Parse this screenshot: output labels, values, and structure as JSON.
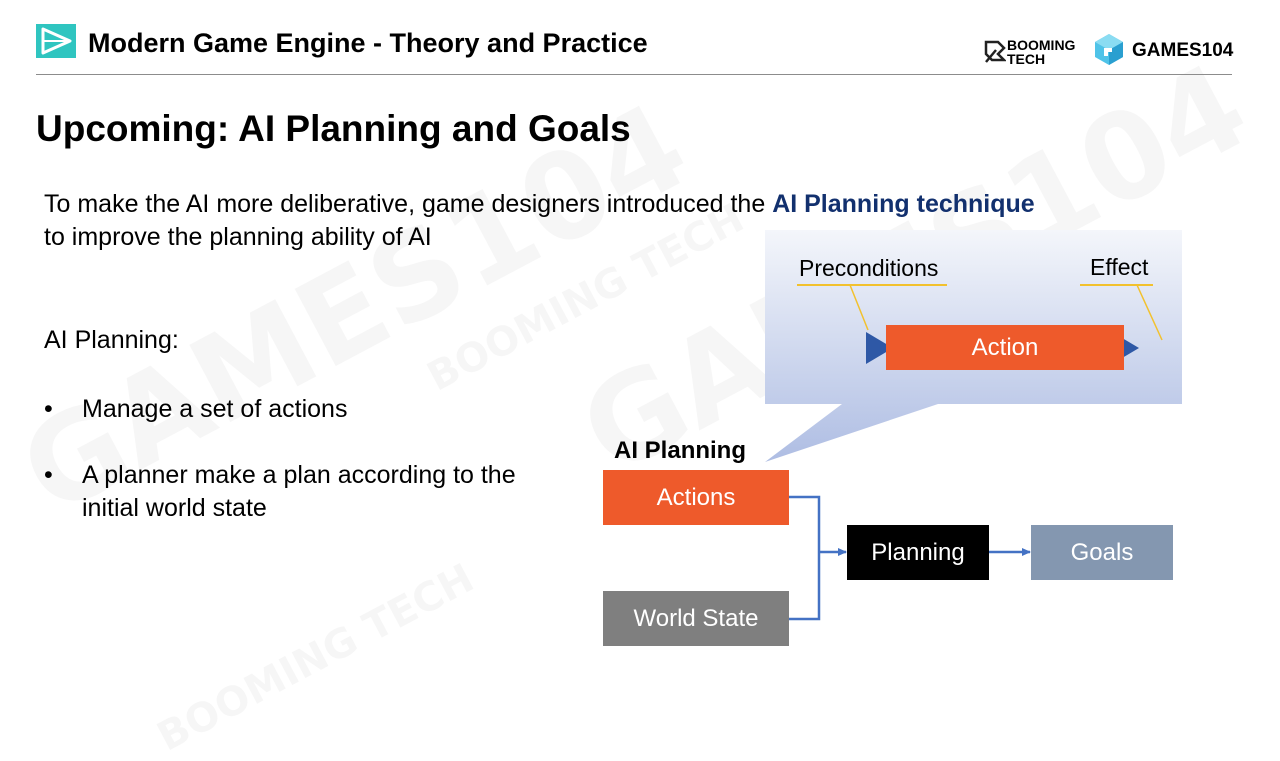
{
  "header": {
    "title": "Modern Game Engine - Theory and Practice",
    "logo_booming_line1": "BOOMING",
    "logo_booming_line2": "TECH",
    "logo_games": "GAMES104"
  },
  "slide": {
    "title": "Upcoming: AI Planning and Goals",
    "intro_line1_pre": "To make the AI more deliberative, game designers introduced the ",
    "intro_line1_highlight": "AI Planning technique",
    "intro_line2": "to improve the planning ability of AI",
    "ai_planning_label": "AI Planning:",
    "bullets": [
      "Manage a set of actions",
      "A planner make a plan according to the initial world state"
    ],
    "bullet_glyph": "•"
  },
  "diagram": {
    "callout": {
      "preconditions": "Preconditions",
      "effect": "Effect",
      "action": "Action"
    },
    "title": "AI Planning",
    "actions": "Actions",
    "world_state": "World State",
    "planning": "Planning",
    "goals": "Goals"
  },
  "watermarks": {
    "games": "GAMES104",
    "booming": "BOOMING TECH"
  },
  "colors": {
    "orange": "#ee5a2b",
    "black": "#000000",
    "grey": "#7f7f7f",
    "steel": "#8497b0",
    "arrow_blue": "#4472c4",
    "triangle_blue": "#2e58a6",
    "highlight_navy": "#12306e",
    "yellow_line": "#f2c12e"
  }
}
